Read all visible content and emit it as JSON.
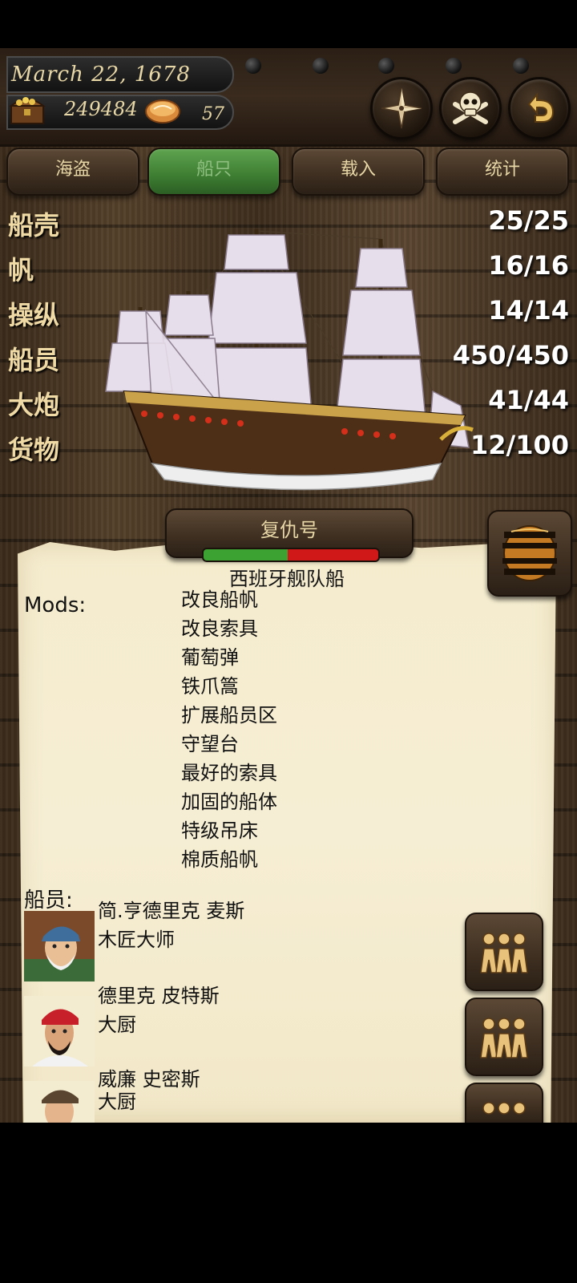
{
  "header": {
    "date": "March 22, 1678",
    "gold": "249484",
    "food": "57"
  },
  "tabs": [
    {
      "label": "海盗"
    },
    {
      "label": "船只"
    },
    {
      "label": "载入"
    },
    {
      "label": "统计"
    }
  ],
  "active_tab": "船只",
  "stats": [
    {
      "label": "船壳",
      "value": "25/25"
    },
    {
      "label": "帆",
      "value": "16/16"
    },
    {
      "label": "操纵",
      "value": "14/14"
    },
    {
      "label": "船员",
      "value": "450/450"
    },
    {
      "label": "大炮",
      "value": "41/44"
    },
    {
      "label": "货物",
      "value": "12/100"
    }
  ],
  "ship": {
    "name": "复仇号",
    "type": "西班牙舰队船",
    "health_fraction": 0.48
  },
  "mods": {
    "label": "Mods:",
    "items": [
      "改良船帆",
      "改良索具",
      "葡萄弹",
      "铁爪篙",
      "扩展船员区",
      "守望台",
      "最好的索具",
      "加固的船体",
      "特级吊床",
      "棉质船帆"
    ]
  },
  "crew": {
    "label": "船员:",
    "members": [
      {
        "name": "简.亨德里克 麦斯",
        "role": "木匠大师"
      },
      {
        "name": "德里克 皮特斯",
        "role": "大厨"
      },
      {
        "name": "威廉 史密斯",
        "role": "大厨"
      }
    ]
  },
  "colors": {
    "active_tab": "#3d7d32",
    "health_green": "#3ca333",
    "health_red": "#d01818",
    "parchment": "#f5ecce"
  }
}
